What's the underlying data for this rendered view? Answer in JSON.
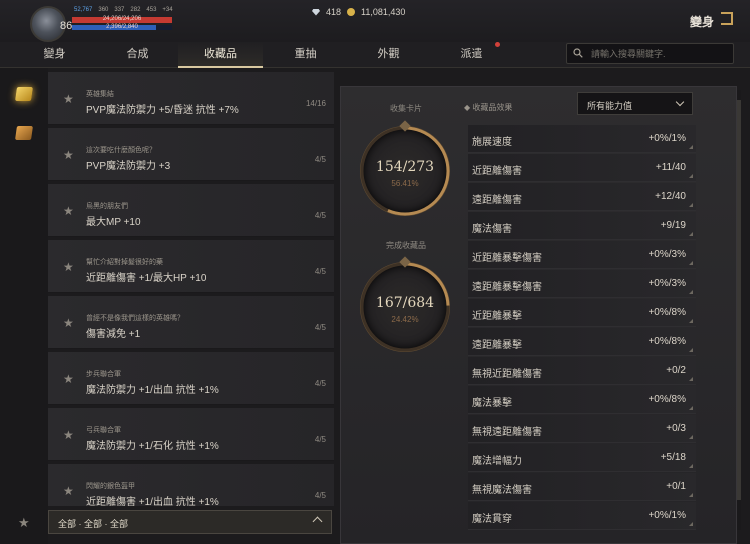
{
  "player": {
    "level": "86",
    "stats": [
      "52,767",
      "360",
      "337",
      "282",
      "453",
      "+34"
    ],
    "hp": {
      "text": "24,206/24,206",
      "fraction": 1.0
    },
    "mp": {
      "text": "2,396/2,840",
      "fraction": 0.84
    }
  },
  "currency": {
    "gems": "418",
    "coins": "11,081,430"
  },
  "corner_title": "變身",
  "tabs": [
    {
      "label": "變身",
      "active": false
    },
    {
      "label": "合成",
      "active": false
    },
    {
      "label": "收藏品",
      "active": true
    },
    {
      "label": "重抽",
      "active": false
    },
    {
      "label": "外觀",
      "active": false
    },
    {
      "label": "派遣",
      "active": false,
      "notify": true
    }
  ],
  "search": {
    "placeholder": "請輸入搜尋關鍵字."
  },
  "collections": [
    {
      "title": "英雄集結",
      "effect": "PVP魔法防禦力 +5/昏迷 抗性 +7%",
      "count": "14/16"
    },
    {
      "title": "這次要吃什麼顏色呢？",
      "effect": "PVP魔法防禦力 +3",
      "count": "4/5"
    },
    {
      "title": "烏黑的朋友們",
      "effect": "最大MP +10",
      "count": "4/5"
    },
    {
      "title": "幫忙介紹對掉髮很好的藥",
      "effect": "近距離傷害 +1/最大HP +10",
      "count": "4/5"
    },
    {
      "title": "曾經不是像我們這樣的英雄嗎？",
      "effect": "傷害減免 +1",
      "count": "4/5"
    },
    {
      "title": "步兵聯合軍",
      "effect": "魔法防禦力 +1/出血 抗性 +1%",
      "count": "4/5"
    },
    {
      "title": "弓兵聯合軍",
      "effect": "魔法防禦力 +1/石化 抗性 +1%",
      "count": "4/5"
    },
    {
      "title": "閃耀的銀色盔甲",
      "effect": "近距離傷害 +1/出血 抗性 +1%",
      "count": "4/5"
    }
  ],
  "filter": {
    "label": "全部 · 全部 · 全部"
  },
  "summary": {
    "cards": {
      "label": "收集卡片",
      "value": "154/273",
      "percent": "56.41%",
      "fraction": 0.5641
    },
    "completed": {
      "label": "完成收藏品",
      "value": "167/684",
      "percent": "24.42%",
      "fraction": 0.2442
    }
  },
  "effects_header": "收藏品效果",
  "effects_filter": "所有能力值",
  "effects": [
    {
      "name": "施展速度",
      "value": "+0%/1%"
    },
    {
      "name": "近距離傷害",
      "value": "+11/40"
    },
    {
      "name": "遠距離傷害",
      "value": "+12/40"
    },
    {
      "name": "魔法傷害",
      "value": "+9/19"
    },
    {
      "name": "近距離暴擊傷害",
      "value": "+0%/3%"
    },
    {
      "name": "遠距離暴擊傷害",
      "value": "+0%/3%"
    },
    {
      "name": "近距離暴擊",
      "value": "+0%/8%"
    },
    {
      "name": "遠距離暴擊",
      "value": "+0%/8%"
    },
    {
      "name": "無視近距離傷害",
      "value": "+0/2"
    },
    {
      "name": "魔法暴擊",
      "value": "+0%/8%"
    },
    {
      "name": "無視遠距離傷害",
      "value": "+0/3"
    },
    {
      "name": "魔法增幅力",
      "value": "+5/18"
    },
    {
      "name": "無視魔法傷害",
      "value": "+0/1"
    },
    {
      "name": "魔法貫穿",
      "value": "+0%/1%"
    }
  ],
  "colors": {
    "accent": "#d8c8a0",
    "hp": "#c43a32",
    "mp": "#2e5fb8",
    "ring": "#b58a52"
  }
}
